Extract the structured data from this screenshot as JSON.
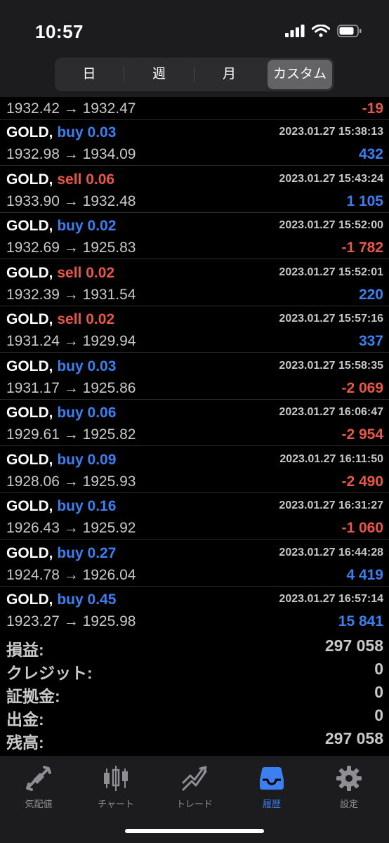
{
  "status_bar": {
    "time": "10:57"
  },
  "period_tabs": [
    {
      "label": "日",
      "active": false
    },
    {
      "label": "週",
      "active": false
    },
    {
      "label": "月",
      "active": false
    },
    {
      "label": "カスタム",
      "active": true
    }
  ],
  "partial_row": {
    "prices": "1932.42 → 1932.47",
    "profit": "-19"
  },
  "trades": [
    {
      "symbol": "GOLD,",
      "side": "buy",
      "side_label": "buy 0.03",
      "time": "2023.01.27 15:38:13",
      "prices": "1932.98 → 1934.09",
      "profit": "432"
    },
    {
      "symbol": "GOLD,",
      "side": "sell",
      "side_label": "sell 0.06",
      "time": "2023.01.27 15:43:24",
      "prices": "1933.90 → 1932.48",
      "profit": "1 105"
    },
    {
      "symbol": "GOLD,",
      "side": "buy",
      "side_label": "buy 0.02",
      "time": "2023.01.27 15:52:00",
      "prices": "1932.69 → 1925.83",
      "profit": "-1 782"
    },
    {
      "symbol": "GOLD,",
      "side": "sell",
      "side_label": "sell 0.02",
      "time": "2023.01.27 15:52:01",
      "prices": "1932.39 → 1931.54",
      "profit": "220"
    },
    {
      "symbol": "GOLD,",
      "side": "sell",
      "side_label": "sell 0.02",
      "time": "2023.01.27 15:57:16",
      "prices": "1931.24 → 1929.94",
      "profit": "337"
    },
    {
      "symbol": "GOLD,",
      "side": "buy",
      "side_label": "buy 0.03",
      "time": "2023.01.27 15:58:35",
      "prices": "1931.17 → 1925.86",
      "profit": "-2 069"
    },
    {
      "symbol": "GOLD,",
      "side": "buy",
      "side_label": "buy 0.06",
      "time": "2023.01.27 16:06:47",
      "prices": "1929.61 → 1925.82",
      "profit": "-2 954"
    },
    {
      "symbol": "GOLD,",
      "side": "buy",
      "side_label": "buy 0.09",
      "time": "2023.01.27 16:11:50",
      "prices": "1928.06 → 1925.93",
      "profit": "-2 490"
    },
    {
      "symbol": "GOLD,",
      "side": "buy",
      "side_label": "buy 0.16",
      "time": "2023.01.27 16:31:27",
      "prices": "1926.43 → 1925.92",
      "profit": "-1 060"
    },
    {
      "symbol": "GOLD,",
      "side": "buy",
      "side_label": "buy 0.27",
      "time": "2023.01.27 16:44:28",
      "prices": "1924.78 → 1926.04",
      "profit": "4 419"
    },
    {
      "symbol": "GOLD,",
      "side": "buy",
      "side_label": "buy 0.45",
      "time": "2023.01.27 16:57:14",
      "prices": "1923.27 → 1925.98",
      "profit": "15 841"
    }
  ],
  "summary": [
    {
      "label": "損益:",
      "value": "297 058"
    },
    {
      "label": "クレジット:",
      "value": "0"
    },
    {
      "label": "証拠金:",
      "value": "0"
    },
    {
      "label": "出金:",
      "value": "0"
    },
    {
      "label": "残高:",
      "value": "297 058"
    }
  ],
  "tabbar": [
    {
      "label": "気配値",
      "icon": "quotes-icon",
      "active": false
    },
    {
      "label": "チャート",
      "icon": "chart-icon",
      "active": false
    },
    {
      "label": "トレード",
      "icon": "trade-icon",
      "active": false
    },
    {
      "label": "履歴",
      "icon": "history-icon",
      "active": true
    },
    {
      "label": "設定",
      "icon": "settings-icon",
      "active": false
    }
  ],
  "colors": {
    "buy": "#3c7ff0",
    "sell": "#e8574a",
    "profit_pos": "#3c7ff0",
    "profit_neg": "#e8574a",
    "accent": "#3c7ff0"
  }
}
